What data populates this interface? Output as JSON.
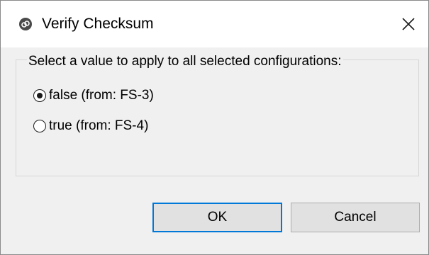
{
  "window": {
    "title": "Verify Checksum",
    "icon": "app-logo-icon",
    "close_icon": "close-icon"
  },
  "group": {
    "prompt": "Select a value to apply to all selected configurations:",
    "options": [
      {
        "label": "false (from: FS-3)",
        "selected": true
      },
      {
        "label": "true (from: FS-4)",
        "selected": false
      }
    ]
  },
  "buttons": {
    "ok_label": "OK",
    "cancel_label": "Cancel"
  },
  "colors": {
    "dialog_background": "#f0f0f0",
    "titlebar_background": "#ffffff",
    "default_button_border": "#0078d7",
    "button_background": "#e1e1e1"
  }
}
